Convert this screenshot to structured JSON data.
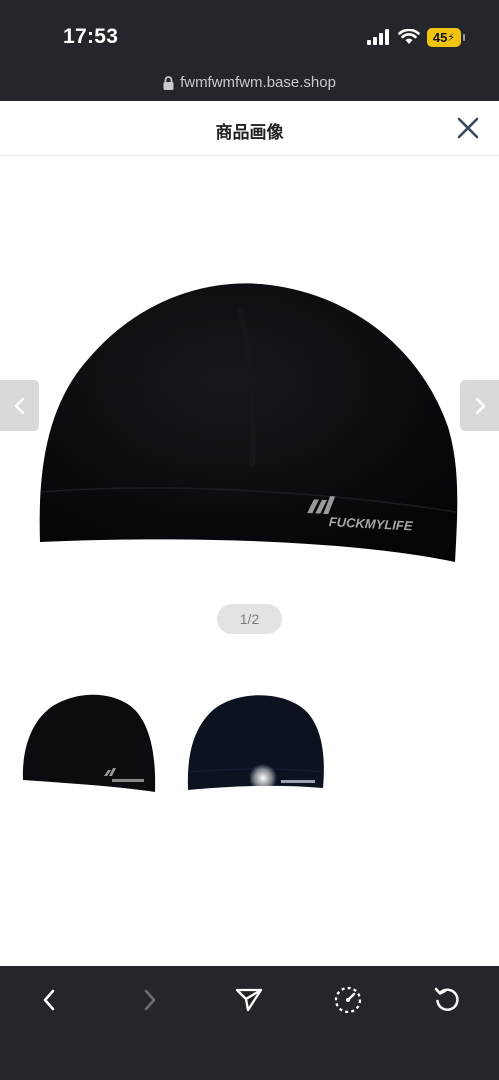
{
  "status_bar": {
    "time": "17:53",
    "battery": "45",
    "icons": [
      "cellular-signal-icon",
      "wifi-icon",
      "battery-charging-icon"
    ]
  },
  "url_bar": {
    "url": "fwmfwmfwm.base.shop",
    "icon": "lock-icon"
  },
  "modal": {
    "title": "商品画像",
    "close_icon": "close-icon"
  },
  "viewer": {
    "counter": "1/2",
    "prev_icon": "chevron-left-icon",
    "next_icon": "chevron-right-icon",
    "image_logo_text": "FUCKMYLIFE",
    "thumbnails": [
      {
        "name": "black-beanie-thumbnail-1",
        "selected": true
      },
      {
        "name": "navy-beanie-thumbnail-2",
        "selected": false
      }
    ]
  },
  "toolbar": {
    "items": [
      "back-icon",
      "forward-icon",
      "share-icon",
      "speed-icon",
      "reload-icon"
    ],
    "forward_enabled": false
  },
  "colors": {
    "chrome": "#24262b",
    "battery": "#f1c40f",
    "beanie": "#0b0b10",
    "nav_arrow": "#d9d9d9"
  }
}
